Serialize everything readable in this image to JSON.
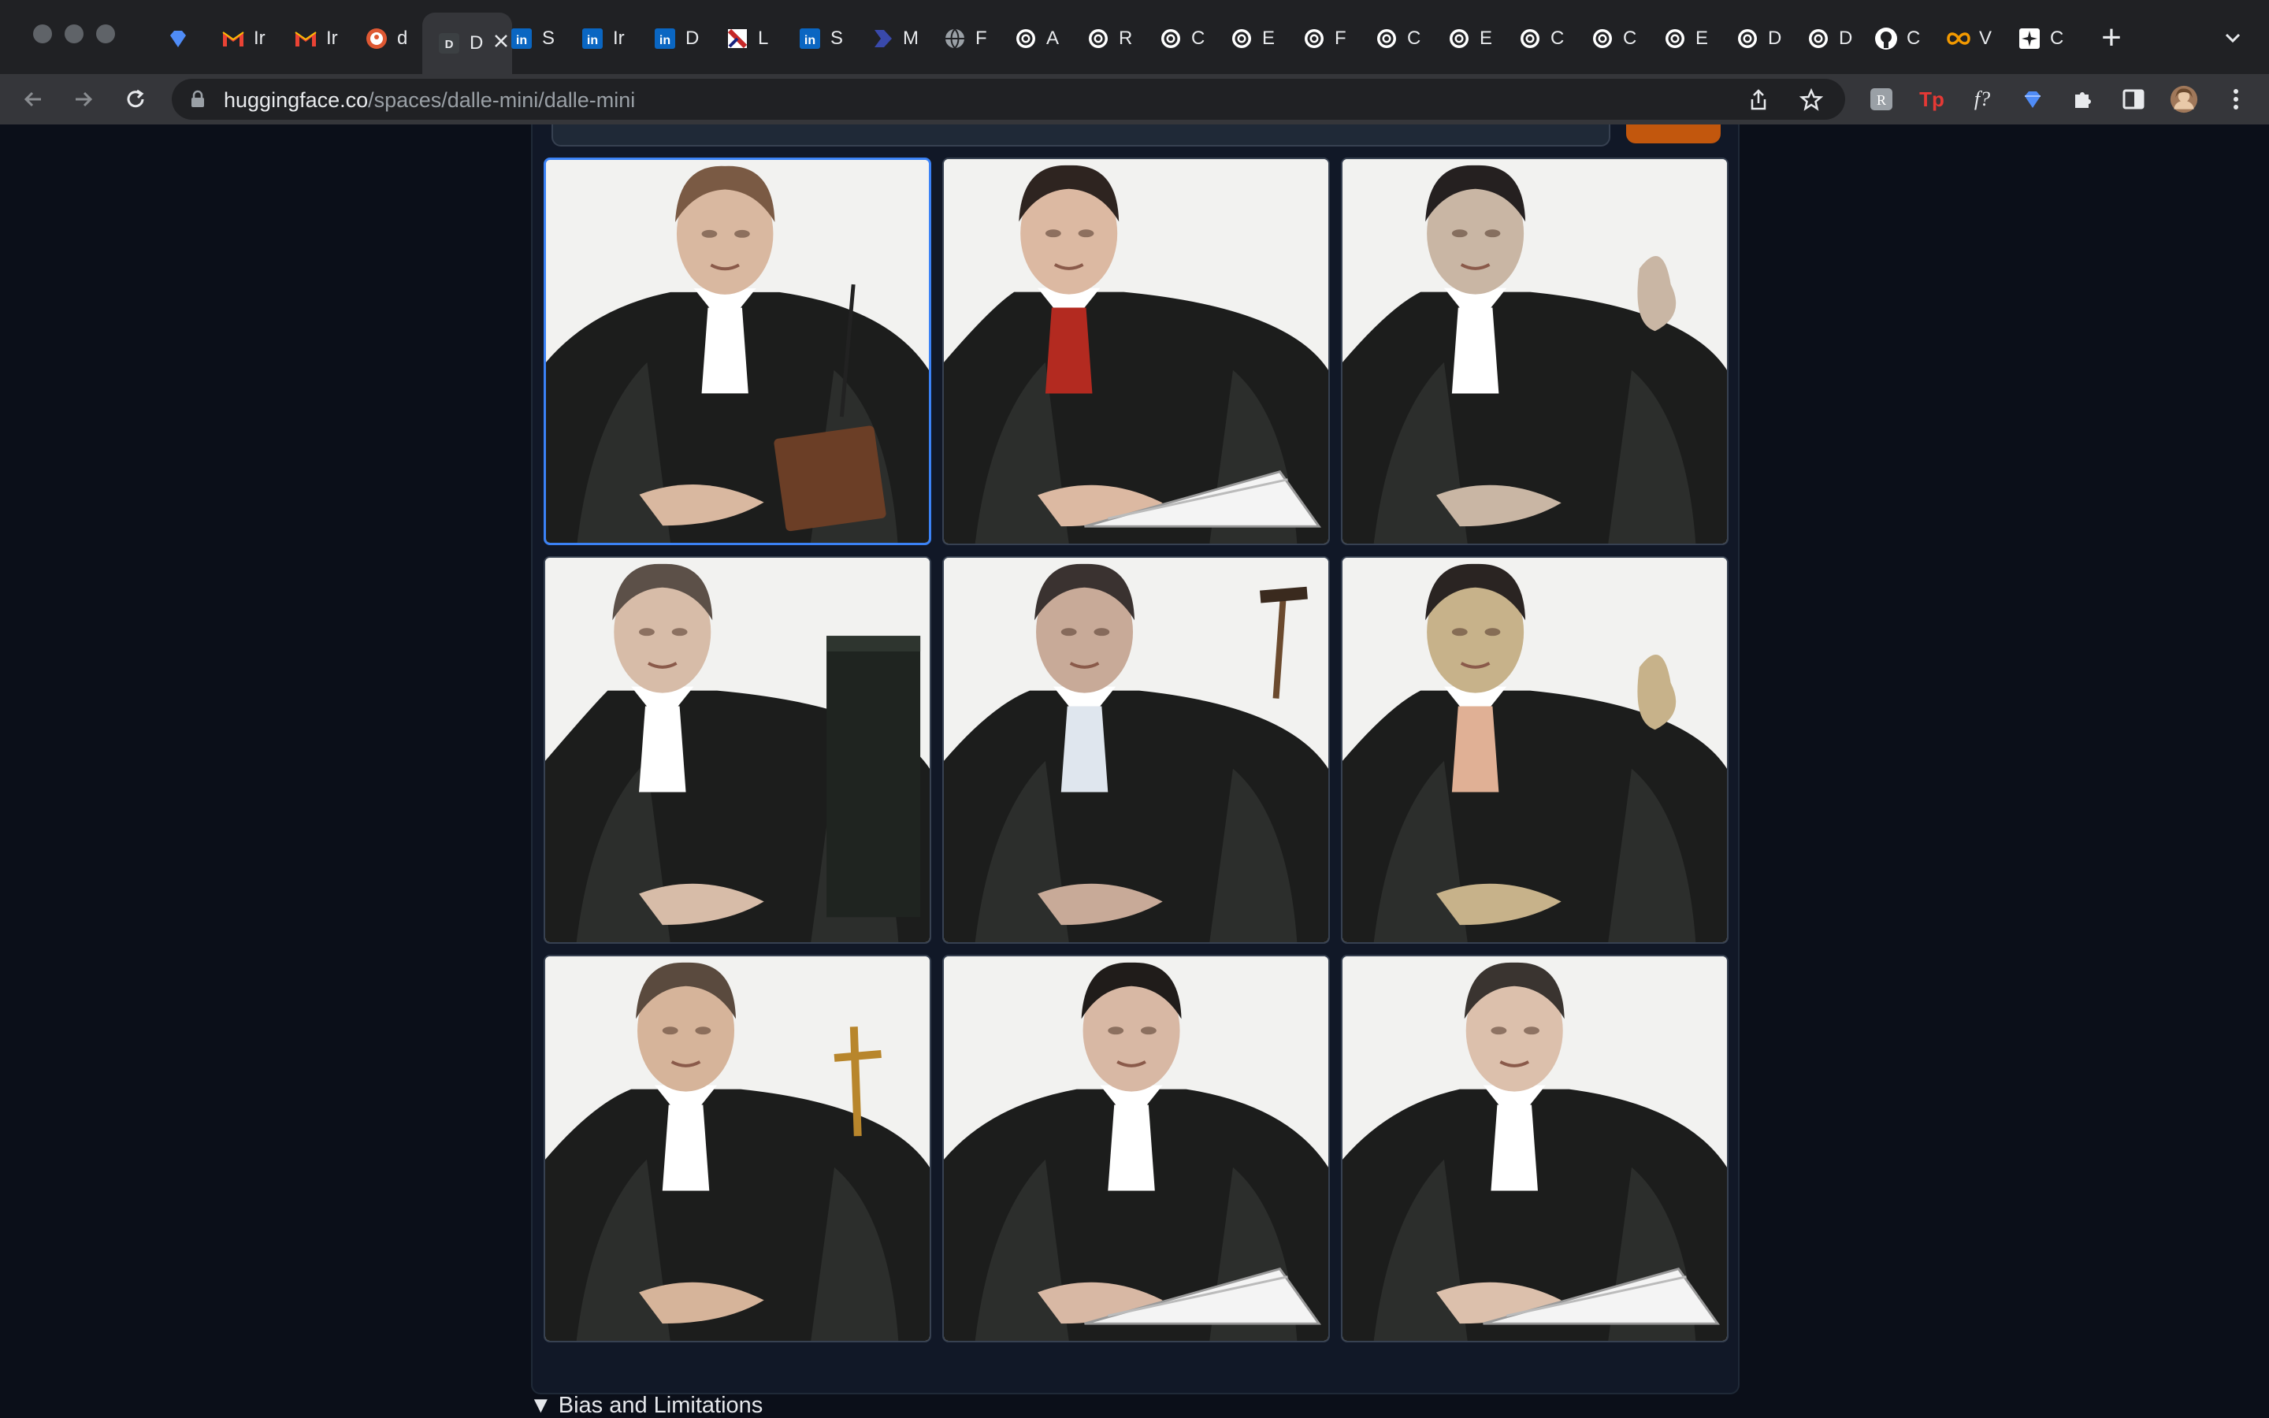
{
  "browser": {
    "tabs": [
      {
        "label": "",
        "icon": "diamond-icon",
        "color": "#4f8cf7"
      },
      {
        "label": "Ir",
        "icon": "gmail-icon",
        "color": "#ea4335"
      },
      {
        "label": "Ir",
        "icon": "gmail-icon",
        "color": "#ea4335"
      },
      {
        "label": "d",
        "icon": "duckduckgo-icon",
        "color": "#de5833"
      },
      {
        "label": "D",
        "icon": "dalle-icon",
        "color": "#35363a",
        "active": true
      },
      {
        "label": "S",
        "icon": "linkedin-icon",
        "color": "#0a66c2"
      },
      {
        "label": "Ir",
        "icon": "linkedin-icon",
        "color": "#0a66c2"
      },
      {
        "label": "D",
        "icon": "linkedin-icon",
        "color": "#0a66c2"
      },
      {
        "label": "L",
        "icon": "doc-icon",
        "color": "#c62828"
      },
      {
        "label": "S",
        "icon": "linkedin-icon",
        "color": "#0a66c2"
      },
      {
        "label": "M",
        "icon": "play-icon",
        "color": "#3949ab"
      },
      {
        "label": "F",
        "icon": "globe-icon",
        "color": "#9aa0a6"
      },
      {
        "label": "A",
        "icon": "openai-icon",
        "color": "#ffffff"
      },
      {
        "label": "R",
        "icon": "openai-icon",
        "color": "#ffffff"
      },
      {
        "label": "C",
        "icon": "openai-icon",
        "color": "#ffffff"
      },
      {
        "label": "E",
        "icon": "openai-icon",
        "color": "#ffffff"
      },
      {
        "label": "F",
        "icon": "openai-icon",
        "color": "#ffffff"
      },
      {
        "label": "C",
        "icon": "openai-icon",
        "color": "#ffffff"
      },
      {
        "label": "E",
        "icon": "openai-icon",
        "color": "#ffffff"
      },
      {
        "label": "C",
        "icon": "openai-icon",
        "color": "#ffffff"
      },
      {
        "label": "C",
        "icon": "openai-icon",
        "color": "#ffffff"
      },
      {
        "label": "E",
        "icon": "openai-icon",
        "color": "#ffffff"
      },
      {
        "label": "D",
        "icon": "openai-icon",
        "color": "#ffffff"
      },
      {
        "label": "D",
        "icon": "openai-icon",
        "color": "#ffffff"
      },
      {
        "label": "C",
        "icon": "github-icon",
        "color": "#ffffff"
      },
      {
        "label": "V",
        "icon": "infinity-icon",
        "color": "#f29900"
      },
      {
        "label": "C",
        "icon": "sparkle-icon",
        "color": "#ffffff"
      }
    ],
    "new_tab": "+",
    "url_domain": "huggingface.co",
    "url_path": "/spaces/dalle-mini/dalle-mini",
    "extensions": [
      "readwise-icon",
      "tp-icon",
      "fquestion-icon",
      "diamond-icon",
      "puzzle-icon",
      "sidepanel-icon",
      "profile-avatar"
    ],
    "extension_labels": {
      "tp": "Tp",
      "fq": "f?"
    }
  },
  "page": {
    "gallery": {
      "selected_index": 0,
      "image_count": 9,
      "subject": "judge"
    },
    "accordion_label": "▼ Bias and Limitations"
  },
  "colors": {
    "page_bg": "#0b0f19",
    "panel_bg": "#111827",
    "accent": "#c2570d",
    "selected_border": "#3b82f6"
  }
}
